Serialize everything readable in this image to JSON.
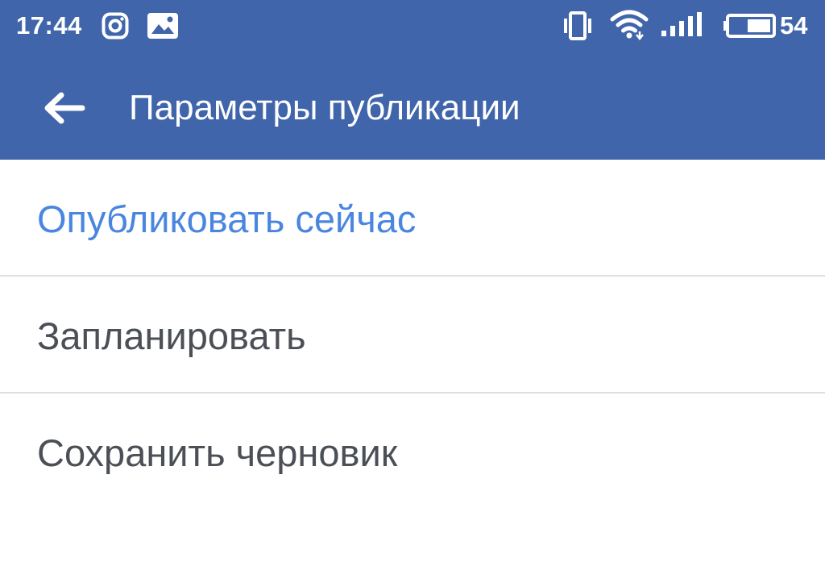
{
  "status_bar": {
    "time": "17:44",
    "battery_level": "54",
    "icons": [
      "instagram-icon",
      "image-icon",
      "vibrate-icon",
      "wifi-icon",
      "signal-icon",
      "battery-icon"
    ]
  },
  "toolbar": {
    "title": "Параметры публикации",
    "back_icon": "arrow-left-icon"
  },
  "options": [
    {
      "label": "Опубликовать сейчас",
      "selected": true
    },
    {
      "label": "Запланировать",
      "selected": false
    },
    {
      "label": "Сохранить черновик",
      "selected": false
    }
  ],
  "colors": {
    "header_bg": "#4065ab",
    "header_text": "#ffffff",
    "selected_text": "#4a86e0",
    "option_text": "#4b4f56",
    "divider": "#dddfe3",
    "background": "#ffffff"
  }
}
